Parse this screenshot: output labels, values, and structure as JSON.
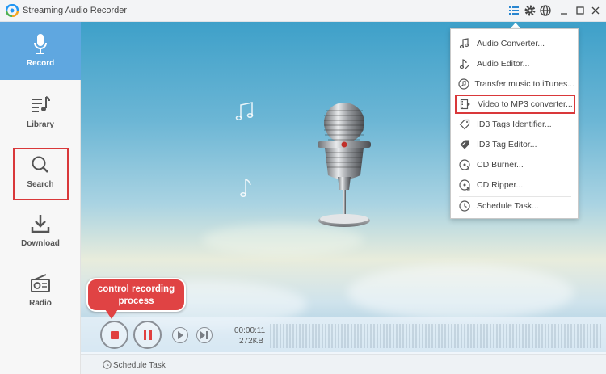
{
  "app": {
    "title": "Streaming Audio Recorder"
  },
  "titlebar_icons": [
    "menu-list-icon",
    "gear-icon",
    "globe-icon",
    "minimize-icon",
    "maximize-icon",
    "close-icon"
  ],
  "sidebar": {
    "items": [
      {
        "label": "Record",
        "icon": "microphone-icon",
        "active": true
      },
      {
        "label": "Library",
        "icon": "library-icon",
        "active": false
      },
      {
        "label": "Search",
        "icon": "search-icon",
        "active": false,
        "highlighted": true
      },
      {
        "label": "Download",
        "icon": "download-icon",
        "active": false
      },
      {
        "label": "Radio",
        "icon": "radio-icon",
        "active": false
      }
    ]
  },
  "menu": {
    "items": [
      {
        "label": "Audio Converter...",
        "icon": "music-note-icon"
      },
      {
        "label": "Audio Editor...",
        "icon": "audio-editor-icon"
      },
      {
        "label": "Transfer music to iTunes...",
        "icon": "itunes-icon"
      },
      {
        "label": "Video to MP3 converter...",
        "icon": "video-convert-icon",
        "highlighted": true
      },
      {
        "label": "ID3 Tags Identifier...",
        "icon": "tag-icon"
      },
      {
        "label": "ID3 Tag Editor...",
        "icon": "tag-edit-icon"
      },
      {
        "label": "CD Burner...",
        "icon": "cd-burn-icon"
      },
      {
        "label": "CD Ripper...",
        "icon": "cd-rip-icon"
      },
      {
        "label": "Schedule Task...",
        "icon": "clock-icon"
      }
    ]
  },
  "callout": {
    "line1": "control recording",
    "line2": "process"
  },
  "recorder": {
    "elapsed": "00:00:11",
    "size": "272KB"
  },
  "status": {
    "schedule_label": "Schedule Task"
  },
  "colors": {
    "accent": "#5fa7e0",
    "highlight_red": "#d9383a",
    "callout_red": "#e04344",
    "stop_red": "#e04040"
  }
}
